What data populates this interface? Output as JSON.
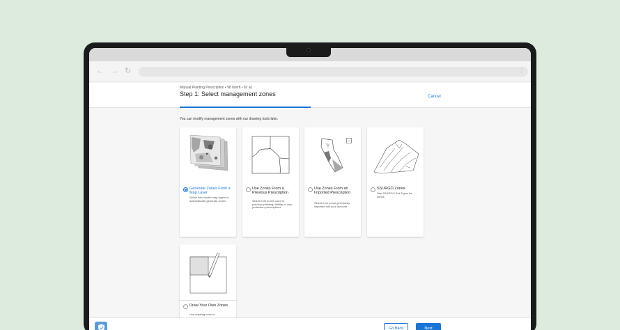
{
  "browser": {
    "back": "←",
    "forward": "→",
    "reload": "↻",
    "menu": "⋮"
  },
  "header": {
    "breadcrumb": "Manual Planting Prescription • 98 North • 82 ac",
    "title": "Step 1: Select management zones",
    "cancel": "Cancel"
  },
  "content": {
    "intro": "You can modify management zones with our drawing tools later.",
    "cards": [
      {
        "title": "Generate Zones From a Map Layer",
        "desc": "Select field health map layers to automatically generate zones.",
        "selected": true
      },
      {
        "title": "Use Zones From a Previous Prescription",
        "desc": "Select from zones used in previous planting, fertility or crop protection prescriptions",
        "selected": false
      },
      {
        "title": "Use Zones From an Imported Prescription",
        "desc": "Select from zones previously imported into your account",
        "selected": false
      },
      {
        "title": "SSURGO Zones",
        "desc": "Use SSURGO Soil Types for zones",
        "selected": false
      },
      {
        "title": "Draw Your Own Zones",
        "desc": "Use drawing tools to",
        "selected": false
      }
    ],
    "badge": "?"
  },
  "footer": {
    "back": "Go Back",
    "next": "Next"
  },
  "colors": {
    "accent": "#1a73d9",
    "background": "#dcebdd",
    "shield": "#5a9bd5"
  }
}
